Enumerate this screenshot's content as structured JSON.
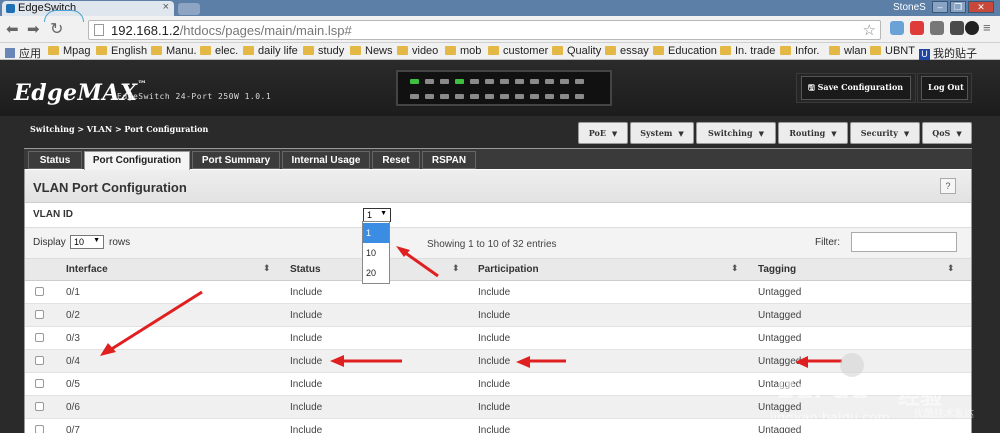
{
  "browser": {
    "tab_title": "EdgeSwitch",
    "tab_close": "×",
    "user": "StoneS",
    "window_buttons": [
      "–",
      "❐",
      "✕"
    ],
    "url_host": "192.168.1.2",
    "url_path": "/htdocs/pages/main/main.lsp#",
    "bookmarks": [
      "应用",
      "Mpag",
      "English",
      "Manu.",
      "elec.",
      "daily life",
      "study",
      "News",
      "video",
      "mob",
      "customer",
      "Quality",
      "essay",
      "Education",
      "In. trade",
      "Infor.",
      "wlan",
      "UBNT",
      "我的贴子"
    ]
  },
  "app": {
    "logo": "EdgeMAX",
    "logo_tm": "™",
    "model": "EdgeSwitch 24-Port 250W 1.0.1",
    "save_btn": "Save Configuration",
    "logout_btn": "Log Out",
    "breadcrumb": "Switching > VLAN > Port Configuration",
    "menu": [
      "PoE",
      "System",
      "Switching",
      "Routing",
      "Security",
      "QoS"
    ],
    "tabs": [
      "Status",
      "Port Configuration",
      "Port Summary",
      "Internal Usage",
      "Reset",
      "RSPAN"
    ],
    "active_tab": "Port Configuration"
  },
  "section": {
    "title": "VLAN Port Configuration",
    "help": "?",
    "vlan_label": "VLAN ID",
    "vlan_selected": "1",
    "vlan_options": [
      "1",
      "10",
      "20"
    ],
    "display_label": "Display",
    "display_value": "10",
    "rows_label": "rows",
    "showing": "Showing 1 to 10 of 32 entries",
    "filter_label": "Filter:"
  },
  "table": {
    "headers": [
      "Interface",
      "Status",
      "Participation",
      "Tagging"
    ],
    "rows": [
      {
        "interface": "0/1",
        "status": "Include",
        "participation": "Include",
        "tagging": "Untagged"
      },
      {
        "interface": "0/2",
        "status": "Include",
        "participation": "Include",
        "tagging": "Untagged"
      },
      {
        "interface": "0/3",
        "status": "Include",
        "participation": "Include",
        "tagging": "Untagged"
      },
      {
        "interface": "0/4",
        "status": "Include",
        "participation": "Include",
        "tagging": "Untagged"
      },
      {
        "interface": "0/5",
        "status": "Include",
        "participation": "Include",
        "tagging": "Untagged"
      },
      {
        "interface": "0/6",
        "status": "Include",
        "participation": "Include",
        "tagging": "Untagged"
      },
      {
        "interface": "0/7",
        "status": "Include",
        "participation": "Include",
        "tagging": "Untagged"
      }
    ]
  },
  "watermark": {
    "brand": "Bai du",
    "cn": "经验",
    "site": "jingyan.baidu.com",
    "tag": "优酷技术发达"
  },
  "colors": {
    "accent": "#3b8de3",
    "annotation": "#e02020",
    "port_active": "#3fbf3f"
  }
}
